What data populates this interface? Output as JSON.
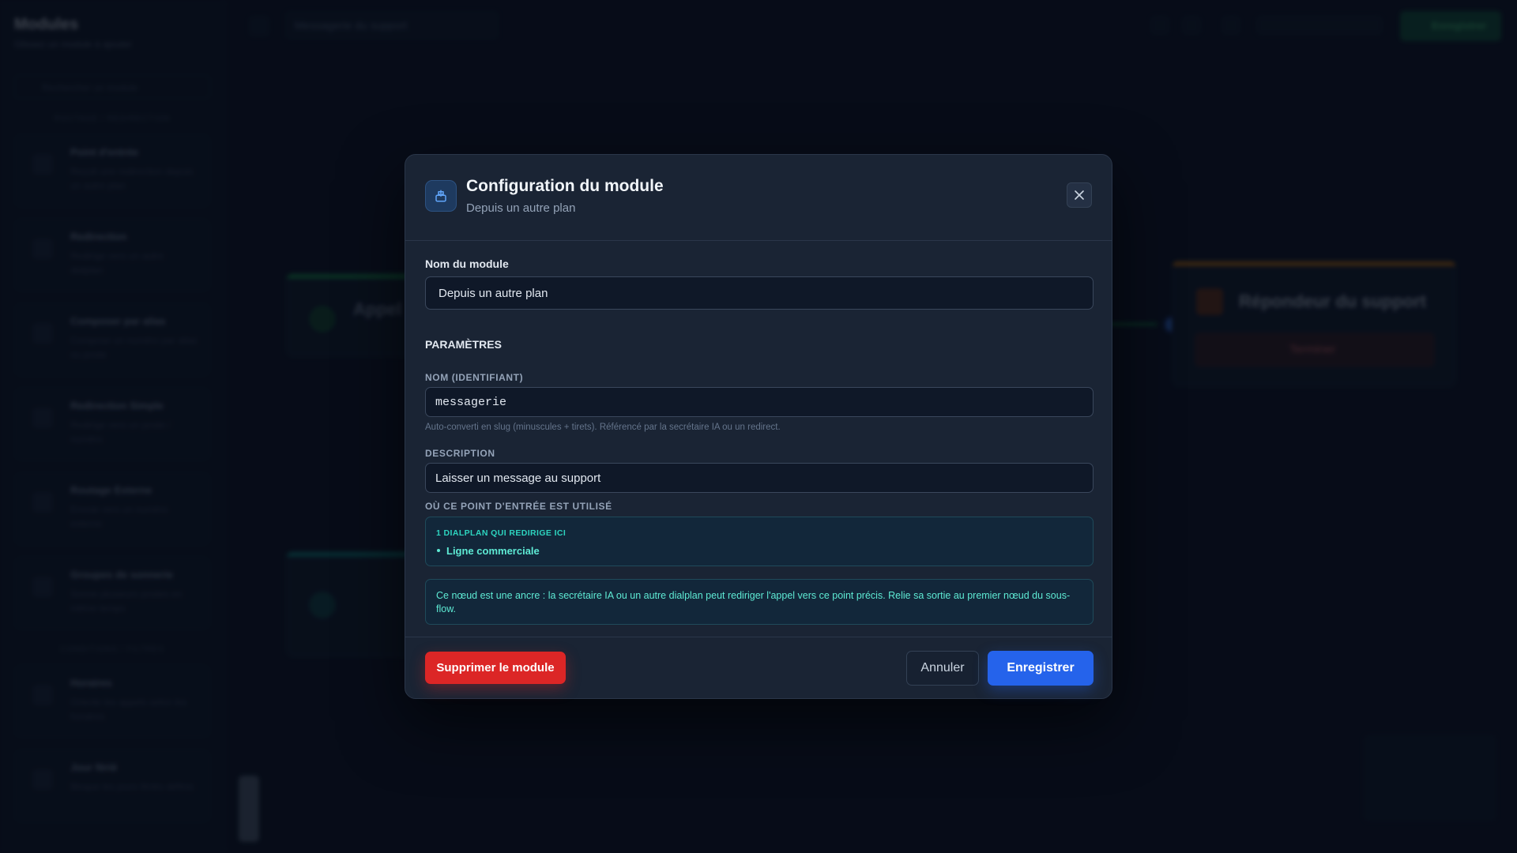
{
  "background": {
    "sidebar": {
      "title": "Modules",
      "subtitle": "Glissez un module à ajouter",
      "search_placeholder": "Rechercher un module",
      "section_1": "ROUTAGE / REDIRECTION",
      "items": [
        {
          "title": "Point d'entrée",
          "desc": "Reçoit une redirection depuis un autre plan"
        },
        {
          "title": "Redirection",
          "desc": "Redirige vers un autre dialplan"
        },
        {
          "title": "Composer par alias",
          "desc": "Compose un numéro par alias ou poste"
        },
        {
          "title": "Redirection Simple",
          "desc": "Redirige vers un poste / numéro"
        },
        {
          "title": "Routage Externe",
          "desc": "Envoie vers un numéro externe"
        },
        {
          "title": "Groupes de sonnerie",
          "desc": "Sonne plusieurs postes en même temps"
        }
      ],
      "section_2": "CONDITIONS / FILTRES",
      "items_2": [
        {
          "title": "Horaires",
          "desc": "Oriente les appels selon les horaires"
        },
        {
          "title": "Jour férié",
          "desc": "Bloque les jours fériés définis"
        }
      ]
    },
    "topbar": {
      "flow_title": "Messagerie du support",
      "save_label": "Enregistrer"
    },
    "nodes": {
      "left_title": "Appel",
      "right_title": "Répondeur du support",
      "right_action": "Terminer"
    }
  },
  "modal": {
    "title": "Configuration du module",
    "subtitle": "Depuis un autre plan",
    "icon": "entry-point-icon",
    "close_icon": "close-icon",
    "module_name_label": "Nom du module",
    "module_name_value": "Depuis un autre plan",
    "params_section": "PARAMÈTRES",
    "name_label": "NOM (IDENTIFIANT)",
    "name_value": "messagerie",
    "name_hint": "Auto-converti en slug (minuscules + tirets). Référencé par la secrétaire IA ou un redirect.",
    "description_label": "DESCRIPTION",
    "description_value": "Laisser un message au support",
    "usage_label": "OÙ CE POINT D'ENTRÉE EST UTILISÉ",
    "usage_heading": "1 DIALPLAN QUI REDIRIGE ICI",
    "usage_items": [
      "Ligne commerciale"
    ],
    "anchor_note": "Ce nœud est une ancre : la secrétaire IA ou un autre dialplan peut rediriger l'appel vers ce point précis. Relie sa sortie au premier nœud du sous-flow.",
    "delete_label": "Supprimer le module",
    "cancel_label": "Annuler",
    "save_label": "Enregistrer"
  },
  "colors": {
    "accent_blue": "#2563eb",
    "danger_red": "#dc2626",
    "info_teal": "#5eead4",
    "modal_bg": "#1a2434"
  }
}
